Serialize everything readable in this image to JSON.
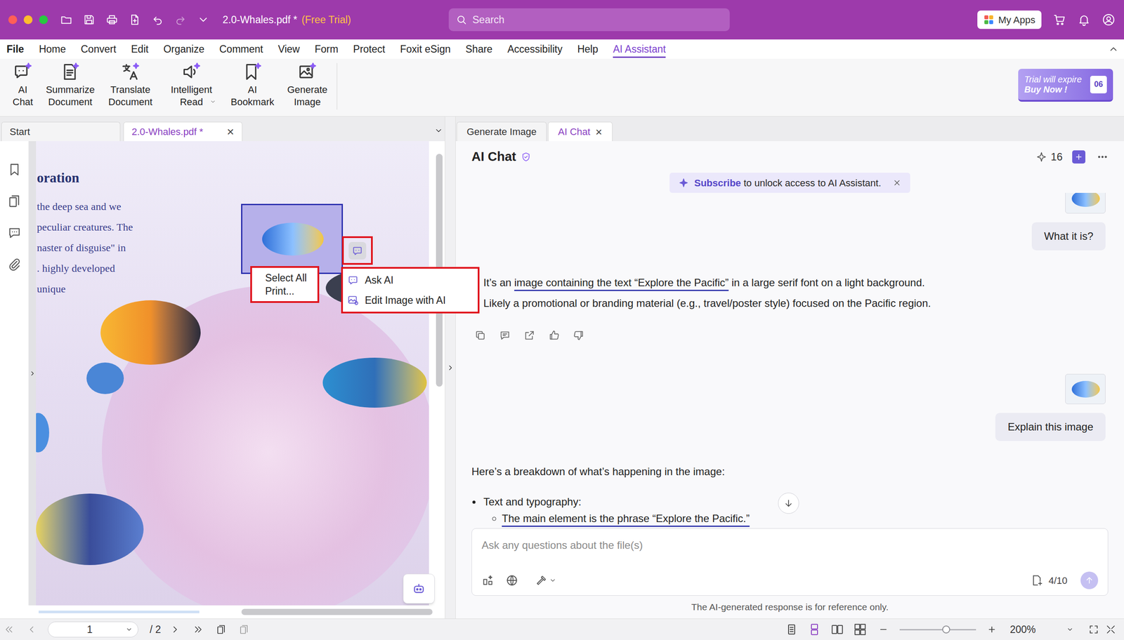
{
  "window": {
    "title": "2.0-Whales.pdf *",
    "trial": "(Free Trial)",
    "search_placeholder": "Search",
    "my_apps": "My Apps"
  },
  "menu": [
    {
      "label": "File",
      "selected": false
    },
    {
      "label": "Home",
      "selected": false
    },
    {
      "label": "Convert",
      "selected": false
    },
    {
      "label": "Edit",
      "selected": false
    },
    {
      "label": "Organize",
      "selected": false
    },
    {
      "label": "Comment",
      "selected": false
    },
    {
      "label": "View",
      "selected": false
    },
    {
      "label": "Form",
      "selected": false
    },
    {
      "label": "Protect",
      "selected": false
    },
    {
      "label": "Foxit eSign",
      "selected": false
    },
    {
      "label": "Share",
      "selected": false
    },
    {
      "label": "Accessibility",
      "selected": false
    },
    {
      "label": "Help",
      "selected": false
    },
    {
      "label": "AI Assistant",
      "selected": true
    }
  ],
  "ribbon": {
    "buttons": [
      {
        "lines": [
          "AI",
          "Chat"
        ],
        "dropdown": false
      },
      {
        "lines": [
          "Summarize",
          "Document"
        ],
        "dropdown": false
      },
      {
        "lines": [
          "Translate",
          "Document"
        ],
        "dropdown": false
      },
      {
        "lines": [
          "Intelligent",
          "Read"
        ],
        "dropdown": true
      },
      {
        "lines": [
          "AI",
          "Bookmark"
        ],
        "dropdown": false
      },
      {
        "lines": [
          "Generate",
          "Image"
        ],
        "dropdown": false
      }
    ],
    "trial_banner": {
      "line1": "Trial will expire",
      "line2": "Buy Now !",
      "days": "06"
    }
  },
  "doc_tabs": [
    {
      "label": "Start",
      "selected": false
    },
    {
      "label": "2.0-Whales.pdf *",
      "selected": true,
      "close": "×"
    }
  ],
  "document": {
    "heading": "oration",
    "lines": [
      "the deep sea and we",
      "peculiar creatures. The",
      "naster of disguise\" in",
      ". highly developed",
      "unique"
    ],
    "image_selected": true
  },
  "context_menu": {
    "items": [
      "Select All",
      "Print..."
    ]
  },
  "ai_menu": {
    "items": [
      "Ask AI",
      "Edit Image with AI"
    ]
  },
  "panel_tabs": [
    {
      "label": "Generate Image",
      "selected": false
    },
    {
      "label": "AI Chat",
      "selected": true,
      "close": "×"
    }
  ],
  "chat": {
    "title": "AI Chat",
    "credits": "16",
    "banner": {
      "link": "Subscribe",
      "text": " to unlock access to AI Assistant."
    },
    "messages": [
      {
        "kind": "image"
      },
      {
        "kind": "user",
        "text": "What it is?"
      },
      {
        "kind": "ai",
        "actions": true,
        "lines": [
          {
            "kind": "indented",
            "segments": [
              {
                "text": "It’s an ",
                "underlined": false
              },
              {
                "text": "image containing the text “Explore the Pacific”",
                "underlined": true
              },
              {
                "text": " in a large serif font on a light background.",
                "underlined": false
              }
            ]
          },
          {
            "kind": "indented",
            "segments": [
              {
                "text": "Likely a promotional or branding material (e.g., travel/poster style) focused on the Pacific region.",
                "underlined": false
              }
            ]
          }
        ]
      },
      {
        "kind": "image"
      },
      {
        "kind": "user",
        "text": "Explain this image"
      },
      {
        "kind": "ai",
        "actions": false,
        "lines": [
          {
            "kind": "plain",
            "segments": [
              {
                "text": "Here’s a breakdown of what’s happening in the image:",
                "underlined": false
              }
            ]
          },
          {
            "kind": "disc",
            "segments": [
              {
                "text": "Text and typography:",
                "underlined": false
              }
            ]
          },
          {
            "kind": "circle",
            "segments": [
              {
                "text": "The main element is the phrase “Explore the Pacific.”",
                "underlined": true
              }
            ]
          }
        ]
      }
    ],
    "input": {
      "placeholder": "Ask any questions about the file(s)",
      "count": "4/10"
    },
    "footer": "The AI-generated response is for reference only."
  },
  "status": {
    "page": "1",
    "total": "/ 2",
    "zoom": "200%",
    "zoom_level": 0.61,
    "views": [
      {
        "selected": false
      },
      {
        "selected": true
      },
      {
        "selected": false
      },
      {
        "selected": false
      }
    ]
  }
}
